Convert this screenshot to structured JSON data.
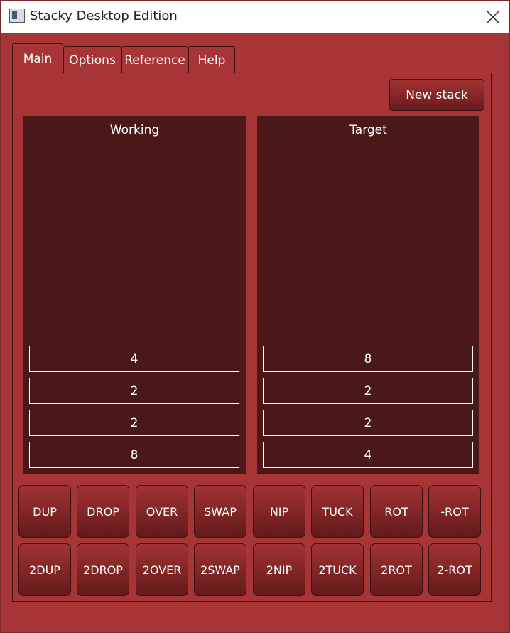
{
  "window": {
    "title": "Stacky Desktop Edition"
  },
  "tabs": [
    {
      "label": "Main"
    },
    {
      "label": "Options"
    },
    {
      "label": "Reference"
    },
    {
      "label": "Help"
    }
  ],
  "toolbar": {
    "new_stack_label": "New stack"
  },
  "working": {
    "label": "Working",
    "values": [
      "4",
      "2",
      "2",
      "8"
    ]
  },
  "target": {
    "label": "Target",
    "values": [
      "8",
      "2",
      "2",
      "4"
    ]
  },
  "ops_row1": [
    "DUP",
    "DROP",
    "OVER",
    "SWAP",
    "NIP",
    "TUCK",
    "ROT",
    "-ROT"
  ],
  "ops_row2": [
    "2DUP",
    "2DROP",
    "2OVER",
    "2SWAP",
    "2NIP",
    "2TUCK",
    "2ROT",
    "2-ROT"
  ]
}
